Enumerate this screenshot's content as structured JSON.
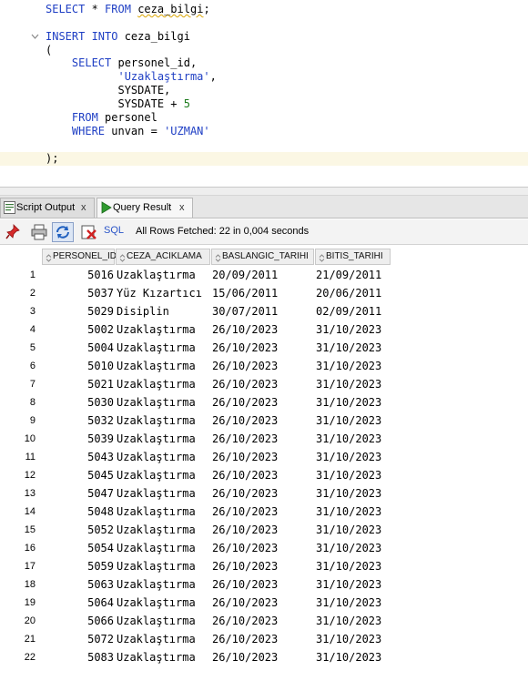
{
  "editor": {
    "lines": [
      {
        "parts": [
          {
            "t": "SELECT",
            "c": "kw"
          },
          {
            "t": " * ",
            "c": "plain"
          },
          {
            "t": "FROM",
            "c": "kw"
          },
          {
            "t": " ",
            "c": "plain"
          },
          {
            "t": "ceza_bilgi",
            "c": "plain squig"
          },
          {
            "t": ";",
            "c": "plain"
          }
        ]
      },
      {
        "parts": []
      },
      {
        "parts": [
          {
            "t": "INSERT INTO",
            "c": "kw"
          },
          {
            "t": " ceza_bilgi",
            "c": "plain"
          }
        ]
      },
      {
        "parts": [
          {
            "t": "(",
            "c": "plain"
          }
        ]
      },
      {
        "parts": [
          {
            "t": "    SELECT",
            "c": "kw"
          },
          {
            "t": " personel_id,",
            "c": "plain"
          }
        ]
      },
      {
        "parts": [
          {
            "t": "           ",
            "c": "plain"
          },
          {
            "t": "'Uzaklaştırma'",
            "c": "str"
          },
          {
            "t": ",",
            "c": "plain"
          }
        ]
      },
      {
        "parts": [
          {
            "t": "           SYSDATE,",
            "c": "plain"
          }
        ]
      },
      {
        "parts": [
          {
            "t": "           SYSDATE + ",
            "c": "plain"
          },
          {
            "t": "5",
            "c": "num"
          }
        ]
      },
      {
        "parts": [
          {
            "t": "    FROM",
            "c": "kw"
          },
          {
            "t": " personel",
            "c": "plain"
          }
        ]
      },
      {
        "parts": [
          {
            "t": "    WHERE",
            "c": "kw"
          },
          {
            "t": " unvan = ",
            "c": "plain"
          },
          {
            "t": "'UZMAN'",
            "c": "str"
          }
        ]
      },
      {
        "parts": []
      },
      {
        "parts": [
          {
            "t": ");",
            "c": "plain"
          }
        ]
      }
    ]
  },
  "tabs": {
    "script_output": "Script Output",
    "query_result": "Query Result",
    "close": "x"
  },
  "toolbar": {
    "sql_label": "SQL",
    "status": "All Rows Fetched: 22 in 0,004 seconds"
  },
  "grid": {
    "columns": [
      "PERSONEL_ID",
      "CEZA_ACIKLAMA",
      "BASLANGIC_TARIHI",
      "BITIS_TARIHI"
    ],
    "rows": [
      [
        "1",
        "5016",
        "Uzaklaştırma",
        "20/09/2011",
        "21/09/2011"
      ],
      [
        "2",
        "5037",
        "Yüz Kızartıcı",
        "15/06/2011",
        "20/06/2011"
      ],
      [
        "3",
        "5029",
        "Disiplin",
        "30/07/2011",
        "02/09/2011"
      ],
      [
        "4",
        "5002",
        "Uzaklaştırma",
        "26/10/2023",
        "31/10/2023"
      ],
      [
        "5",
        "5004",
        "Uzaklaştırma",
        "26/10/2023",
        "31/10/2023"
      ],
      [
        "6",
        "5010",
        "Uzaklaştırma",
        "26/10/2023",
        "31/10/2023"
      ],
      [
        "7",
        "5021",
        "Uzaklaştırma",
        "26/10/2023",
        "31/10/2023"
      ],
      [
        "8",
        "5030",
        "Uzaklaştırma",
        "26/10/2023",
        "31/10/2023"
      ],
      [
        "9",
        "5032",
        "Uzaklaştırma",
        "26/10/2023",
        "31/10/2023"
      ],
      [
        "10",
        "5039",
        "Uzaklaştırma",
        "26/10/2023",
        "31/10/2023"
      ],
      [
        "11",
        "5043",
        "Uzaklaştırma",
        "26/10/2023",
        "31/10/2023"
      ],
      [
        "12",
        "5045",
        "Uzaklaştırma",
        "26/10/2023",
        "31/10/2023"
      ],
      [
        "13",
        "5047",
        "Uzaklaştırma",
        "26/10/2023",
        "31/10/2023"
      ],
      [
        "14",
        "5048",
        "Uzaklaştırma",
        "26/10/2023",
        "31/10/2023"
      ],
      [
        "15",
        "5052",
        "Uzaklaştırma",
        "26/10/2023",
        "31/10/2023"
      ],
      [
        "16",
        "5054",
        "Uzaklaştırma",
        "26/10/2023",
        "31/10/2023"
      ],
      [
        "17",
        "5059",
        "Uzaklaştırma",
        "26/10/2023",
        "31/10/2023"
      ],
      [
        "18",
        "5063",
        "Uzaklaştırma",
        "26/10/2023",
        "31/10/2023"
      ],
      [
        "19",
        "5064",
        "Uzaklaştırma",
        "26/10/2023",
        "31/10/2023"
      ],
      [
        "20",
        "5066",
        "Uzaklaştırma",
        "26/10/2023",
        "31/10/2023"
      ],
      [
        "21",
        "5072",
        "Uzaklaştırma",
        "26/10/2023",
        "31/10/2023"
      ],
      [
        "22",
        "5083",
        "Uzaklaştırma",
        "26/10/2023",
        "31/10/2023"
      ]
    ]
  },
  "icons": [
    "fold-icon",
    "script-output-icon",
    "run-icon",
    "pin-icon",
    "print-icon",
    "refresh-icon",
    "clear-icon",
    "sort-icon",
    "splitter-grip-icon"
  ],
  "colors": {
    "keyword": "#1f3fc4",
    "number": "#1a7a1a",
    "highlight": "#fbf7e4",
    "link": "#2b55c8"
  }
}
